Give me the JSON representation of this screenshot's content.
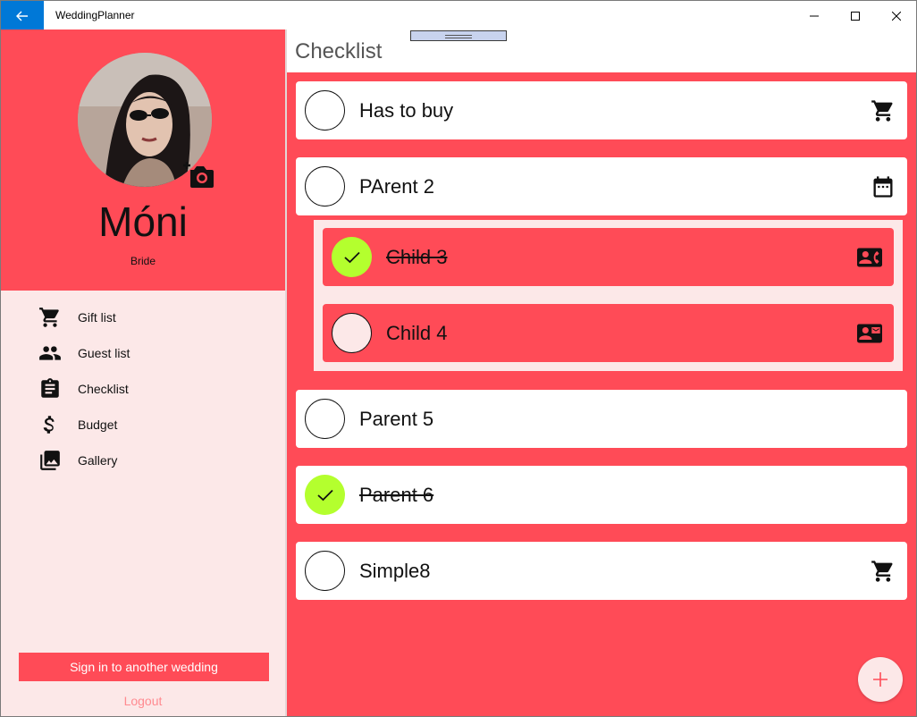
{
  "window": {
    "title": "WeddingPlanner"
  },
  "profile": {
    "name": "Móni",
    "role": "Bride"
  },
  "nav": {
    "items": [
      {
        "label": "Gift list",
        "icon": "cart-icon"
      },
      {
        "label": "Guest list",
        "icon": "people-icon"
      },
      {
        "label": "Checklist",
        "icon": "clipboard-icon"
      },
      {
        "label": "Budget",
        "icon": "dollar-icon"
      },
      {
        "label": "Gallery",
        "icon": "gallery-icon"
      }
    ],
    "signin_label": "Sign in to another wedding",
    "logout_label": "Logout"
  },
  "main": {
    "title": "Checklist",
    "items": [
      {
        "label": "Has to buy",
        "done": false,
        "icon": "cart-icon"
      },
      {
        "label": "PArent 2",
        "done": false,
        "icon": "calendar-icon",
        "children": [
          {
            "label": "Child 3",
            "done": true,
            "icon": "contact-phone-icon"
          },
          {
            "label": "Child 4",
            "done": false,
            "icon": "contact-mail-icon"
          }
        ]
      },
      {
        "label": "Parent 5",
        "done": false,
        "icon": ""
      },
      {
        "label": "Parent 6",
        "done": true,
        "icon": ""
      },
      {
        "label": "Simple8",
        "done": false,
        "icon": "cart-icon"
      }
    ]
  },
  "colors": {
    "accent": "#ff4b57",
    "pane_bg": "#fce8e8",
    "done_check": "#b4ff2e",
    "titlebar_back": "#0078d7"
  }
}
